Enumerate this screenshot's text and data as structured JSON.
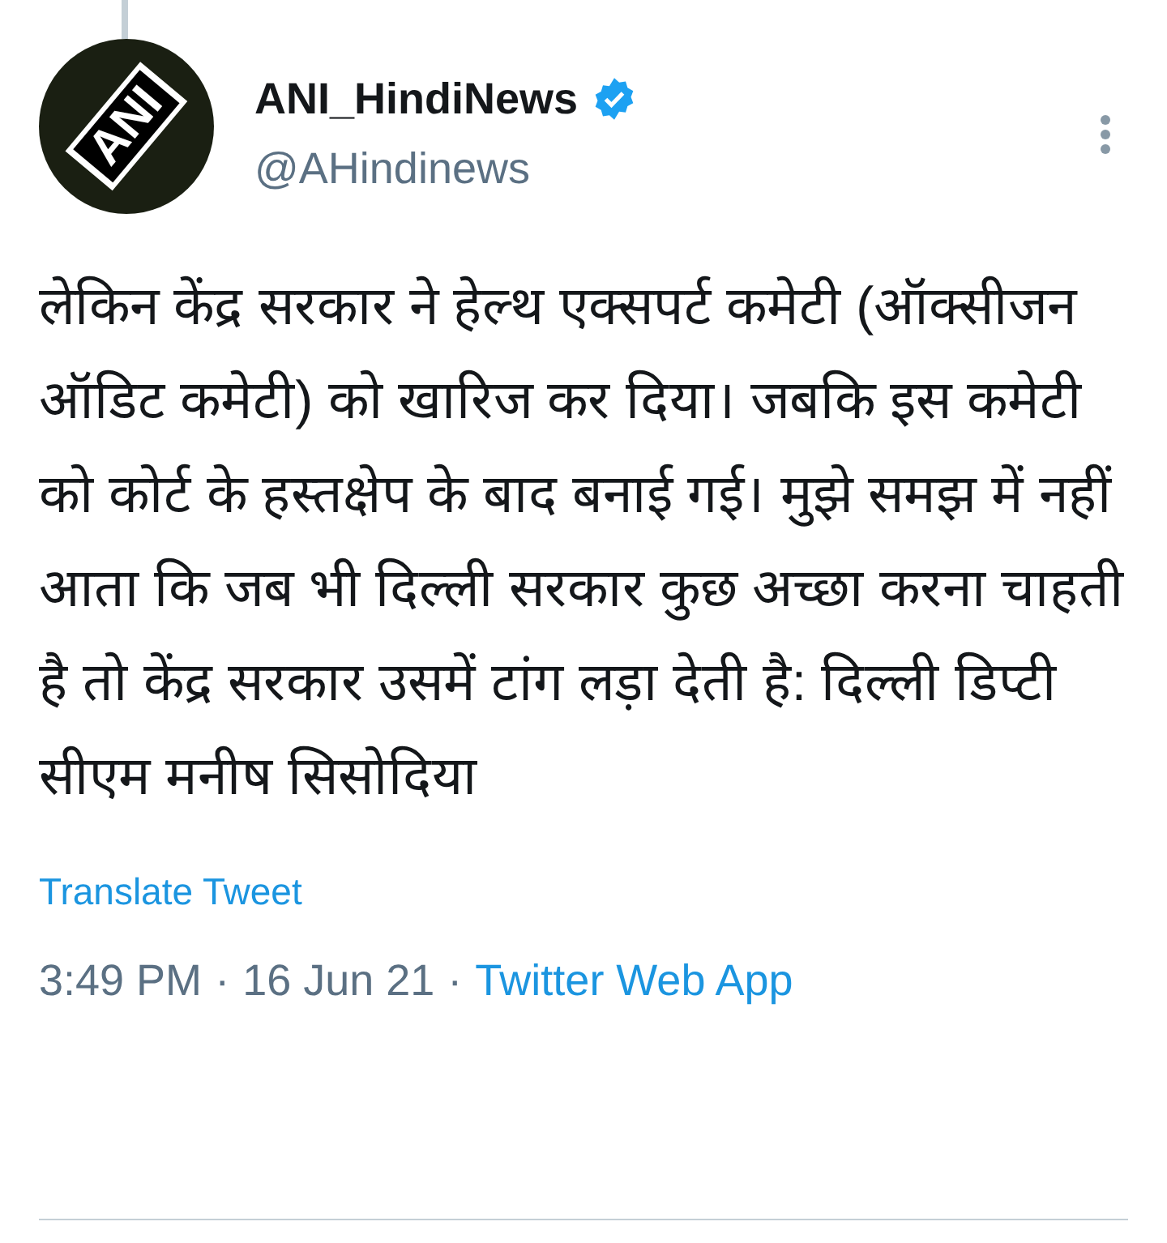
{
  "author": {
    "name": "ANI_HindiNews",
    "verified": true,
    "handle": "@AHindinews",
    "avatar_logo_text": "ANI"
  },
  "tweet_text": "लेकिन केंद्र सरकार ने हेल्थ एक्सपर्ट कमेटी (ऑक्सीजन ऑडिट कमेटी) को खारिज कर दिया। जबकि इस कमेटी को कोर्ट के हस्तक्षेप के बाद बनाई गई। मुझे समझ में नहीं आता कि जब भी दिल्ली सरकार कुछ अच्छा करना चाहती है तो केंद्र सरकार उसमें टांग लड़ा देती है: दिल्ली डिप्टी सीएम मनीष सिसोदिया",
  "translate_link": "Translate Tweet",
  "meta": {
    "time": "3:49 PM",
    "separator_1": "·",
    "date": "16 Jun 21",
    "separator_2": "·",
    "source": "Twitter Web App"
  }
}
